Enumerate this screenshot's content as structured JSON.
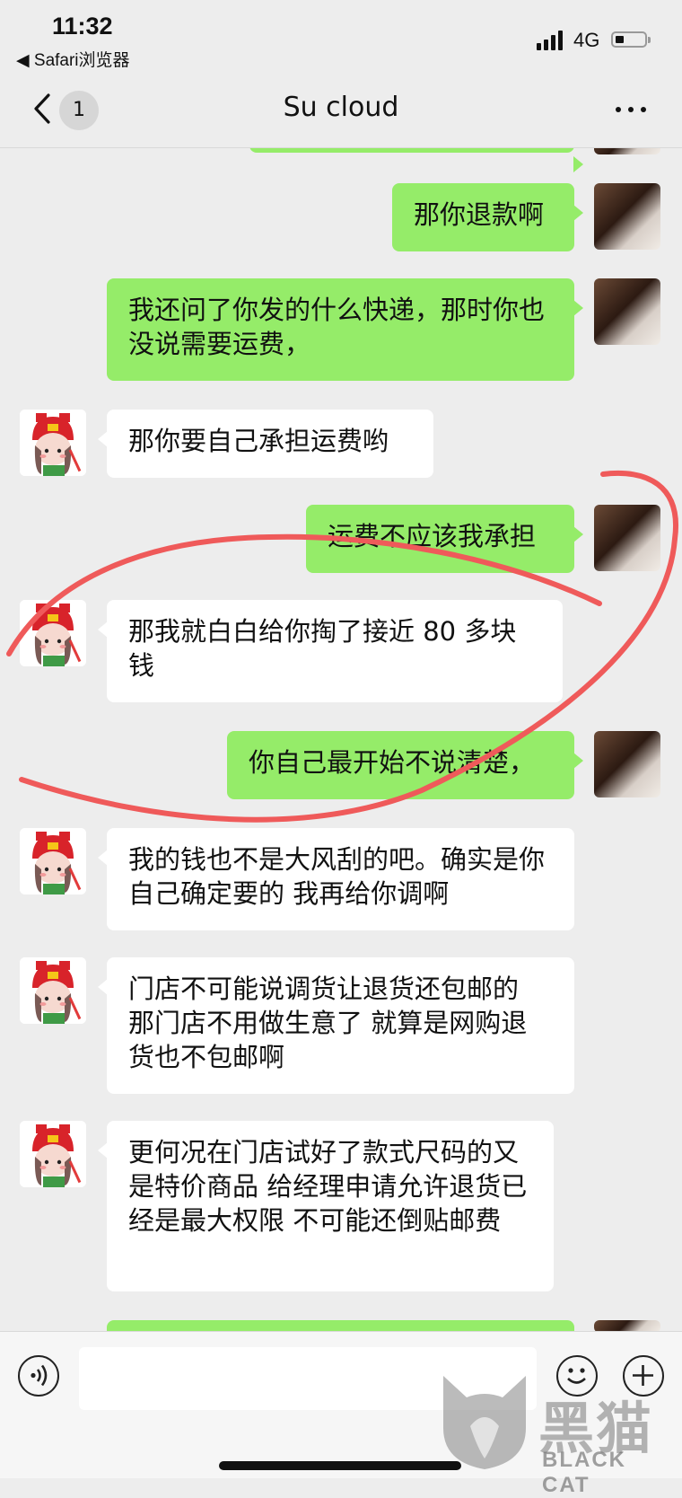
{
  "status_bar": {
    "time": "11:32",
    "back_app": "◀ Safari浏览器",
    "network": "4G"
  },
  "navbar": {
    "unread_count": "1",
    "title": "Su cloud"
  },
  "messages": [
    {
      "side": "self",
      "text": "那你退款啊"
    },
    {
      "side": "self",
      "text": "我还问了你发的什么快递，那时你也没说需要运费，"
    },
    {
      "side": "other",
      "text": "那你要自己承担运费哟"
    },
    {
      "side": "self",
      "text": "运费不应该我承担"
    },
    {
      "side": "other",
      "text": "那我就白白给你掏了接近 80 多块钱"
    },
    {
      "side": "self",
      "text": "你自己最开始不说清楚，"
    },
    {
      "side": "other",
      "text": "我的钱也不是大风刮的吧。确实是你自己确定要的 我再给你调啊"
    },
    {
      "side": "other",
      "text": "门店不可能说调货让退货还包邮的 那门店不用做生意了 就算是网购退货也不包邮啊"
    },
    {
      "side": "other",
      "text": "更何况在门店试好了款式尺码的又是特价商品 给经理申请允许退货已经是最大权限 不可能还倒贴邮费"
    }
  ],
  "watermark": {
    "cn": "黑猫",
    "en": "BLACK CAT"
  },
  "colors": {
    "self_bubble": "#95ec69",
    "other_bubble": "#ffffff",
    "background": "#ededed",
    "annotation": "#ef5a5a"
  }
}
